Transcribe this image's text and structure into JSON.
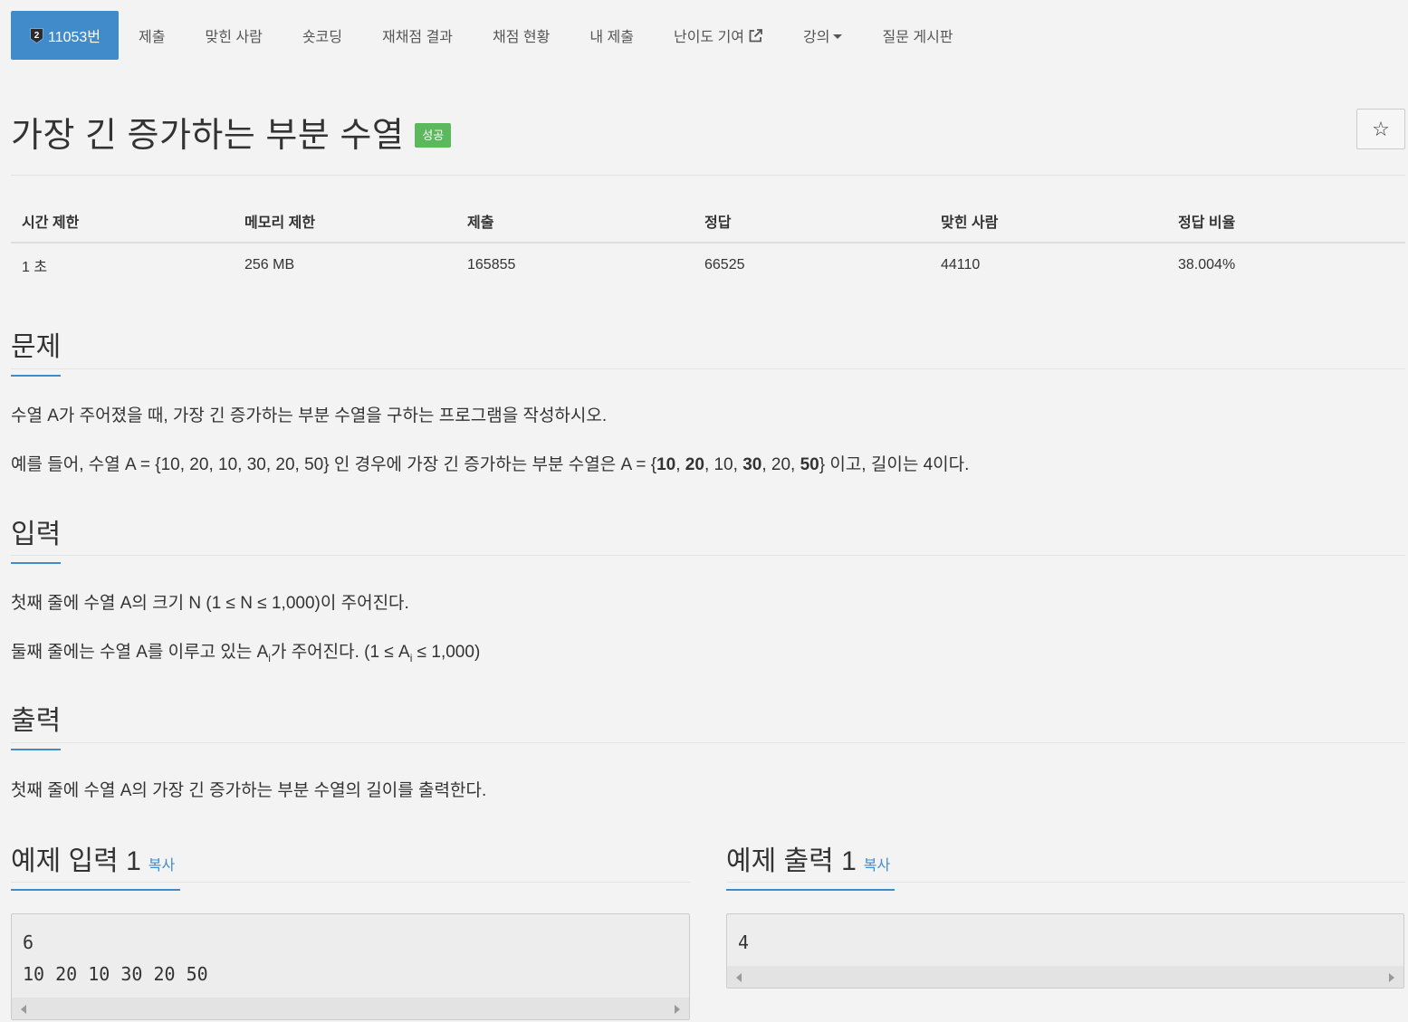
{
  "nav": {
    "problem_no": "11053번",
    "tier": "2",
    "items": [
      "제출",
      "맞힌 사람",
      "숏코딩",
      "재채점 결과",
      "채점 현황",
      "내 제출"
    ],
    "difficulty": "난이도 기여",
    "lecture": "강의",
    "board": "질문 게시판"
  },
  "title": "가장 긴 증가하는 부분 수열",
  "status": "성공",
  "star": "☆",
  "info": {
    "headers": [
      "시간 제한",
      "메모리 제한",
      "제출",
      "정답",
      "맞힌 사람",
      "정답 비율"
    ],
    "values": [
      "1 초",
      "256 MB",
      "165855",
      "66525",
      "44110",
      "38.004%"
    ]
  },
  "sections": {
    "problem": "문제",
    "input": "입력",
    "output": "출력",
    "sample_input": "예제 입력 1",
    "sample_output": "예제 출력 1",
    "copy": "복사"
  },
  "problem": {
    "p1": "수열 A가 주어졌을 때, 가장 긴 증가하는 부분 수열을 구하는 프로그램을 작성하시오.",
    "p2_pre": "예를 들어, 수열 A = {10, 20, 10, 30, 20, 50} 인 경우에 가장 긴 증가하는 부분 수열은 A = {",
    "p2_b1": "10",
    "p2_b2": "20",
    "p2_mid1": ", 10, ",
    "p2_b3": "30",
    "p2_mid2": ", 20, ",
    "p2_b4": "50",
    "p2_post": "} 이고, 길이는 4이다."
  },
  "input": {
    "p1": "첫째 줄에 수열 A의 크기 N (1 ≤ N ≤ 1,000)이 주어진다.",
    "p2_pre": "둘째 줄에는 수열 A를 이루고 있는 A",
    "p2_sub": "i",
    "p2_mid": "가 주어진다. (1 ≤ A",
    "p2_post": " ≤ 1,000)"
  },
  "output": {
    "p1": "첫째 줄에 수열 A의 가장 긴 증가하는 부분 수열의 길이를 출력한다."
  },
  "sample_input": "6\n10 20 10 30 20 50",
  "sample_output": "4"
}
